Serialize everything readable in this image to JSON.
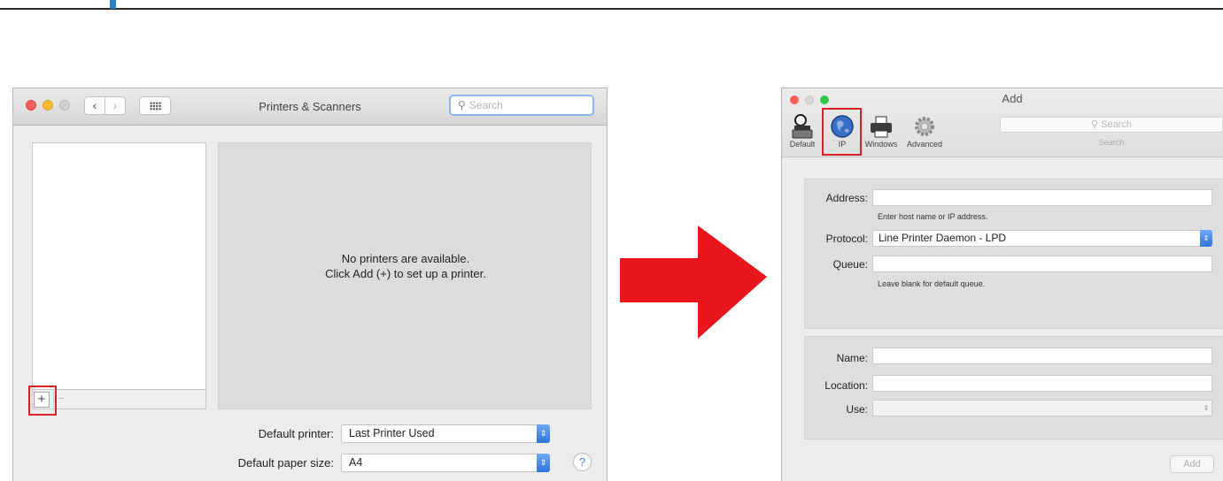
{
  "left_window": {
    "title": "Printers & Scanners",
    "search_placeholder": "Search",
    "nav_back": "‹",
    "nav_forward": "›",
    "empty_message_line1": "No printers are available.",
    "empty_message_line2": "Click Add (+) to set up a printer.",
    "add_symbol": "+",
    "remove_symbol": "−",
    "default_printer_label": "Default printer:",
    "default_printer_value": "Last Printer Used",
    "paper_size_label": "Default paper size:",
    "paper_size_value": "A4",
    "help_symbol": "?"
  },
  "right_window": {
    "title": "Add",
    "toolbar": {
      "default_label": "Default",
      "ip_label": "IP",
      "windows_label": "Windows",
      "advanced_label": "Advanced"
    },
    "search_placeholder": "Search",
    "search_label": "Search",
    "address_label": "Address:",
    "address_value": "",
    "address_hint": "Enter host name or IP address.",
    "protocol_label": "Protocol:",
    "protocol_value": "Line Printer Daemon - LPD",
    "queue_label": "Queue:",
    "queue_value": "",
    "queue_hint": "Leave blank for default queue.",
    "name_label": "Name:",
    "name_value": "",
    "location_label": "Location:",
    "location_value": "",
    "use_label": "Use:",
    "use_value": "",
    "add_button": "Add"
  },
  "colors": {
    "highlight_red": "#d81f26",
    "arrow_red": "#e8151c",
    "accent_blue": "#2e73e0"
  }
}
